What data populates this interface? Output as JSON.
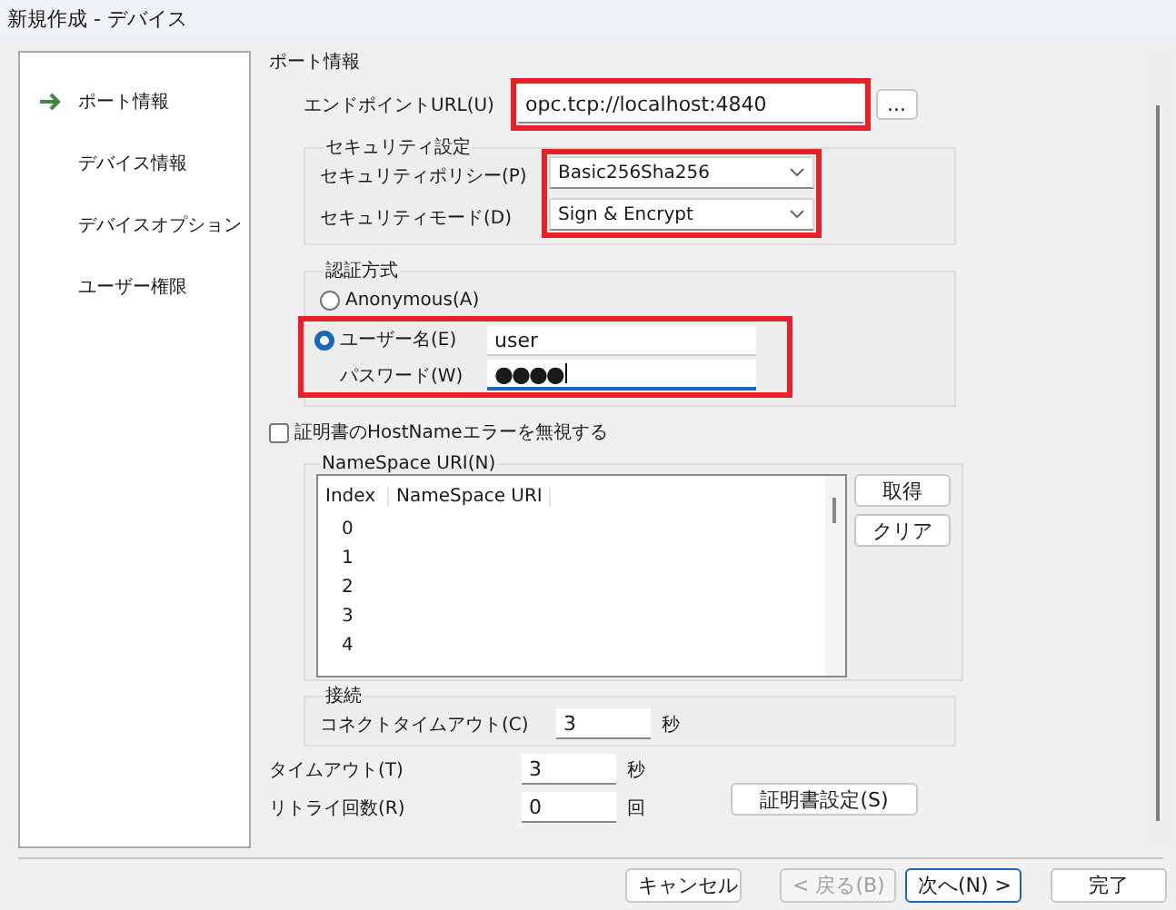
{
  "window": {
    "title": "新規作成 - デバイス"
  },
  "nav": {
    "items": [
      {
        "label": "ポート情報",
        "selected": true
      },
      {
        "label": "デバイス情報",
        "selected": false
      },
      {
        "label": "デバイスオプション",
        "selected": false
      },
      {
        "label": "ユーザー権限",
        "selected": false
      }
    ]
  },
  "page": {
    "heading": "ポート情報",
    "endpoint": {
      "label": "エンドポイントURL(U)",
      "value": "opc.tcp://localhost:4840",
      "browse": "...",
      "highlighted": true
    },
    "security": {
      "legend": "セキュリティ設定",
      "highlighted": true,
      "fields": [
        {
          "label": "セキュリティポリシー(P)",
          "value": "Basic256Sha256"
        },
        {
          "label": "セキュリティモード(D)",
          "value": "Sign & Encrypt"
        }
      ]
    },
    "auth": {
      "legend": "認証方式",
      "highlighted": true,
      "options": [
        {
          "label": "Anonymous(A)",
          "selected": false
        },
        {
          "label": "ユーザー名(E)",
          "selected": true
        }
      ],
      "username": "user",
      "password_label": "パスワード(W)",
      "password_mask": "●●●●",
      "password_focused": true
    },
    "ignore_hostname": {
      "label": "証明書のHostNameエラーを無視する",
      "checked": false
    },
    "namespaces": {
      "legend": "NameSpace URI(N)",
      "columns": [
        "Index",
        "NameSpace URI"
      ],
      "rows": [
        "0",
        "1",
        "2",
        "3",
        "4"
      ],
      "buttons": [
        "取得",
        "クリア"
      ]
    },
    "connection": {
      "legend": "接続",
      "label": "コネクトタイムアウト(C)",
      "value": "3",
      "unit": "秒"
    },
    "timeout": {
      "label": "タイムアウト(T)",
      "value": "3",
      "unit": "秒"
    },
    "retry": {
      "label": "リトライ回数(R)",
      "value": "0",
      "unit": "回"
    },
    "cert_button": "証明書設定(S)"
  },
  "footer": {
    "buttons": [
      {
        "label": "キャンセル",
        "disabled": false,
        "default": false
      },
      {
        "label": "< 戻る(B)",
        "disabled": true,
        "default": false
      },
      {
        "label": "次へ(N) >",
        "disabled": false,
        "default": true
      },
      {
        "label": "完了",
        "disabled": false,
        "default": false
      }
    ]
  }
}
